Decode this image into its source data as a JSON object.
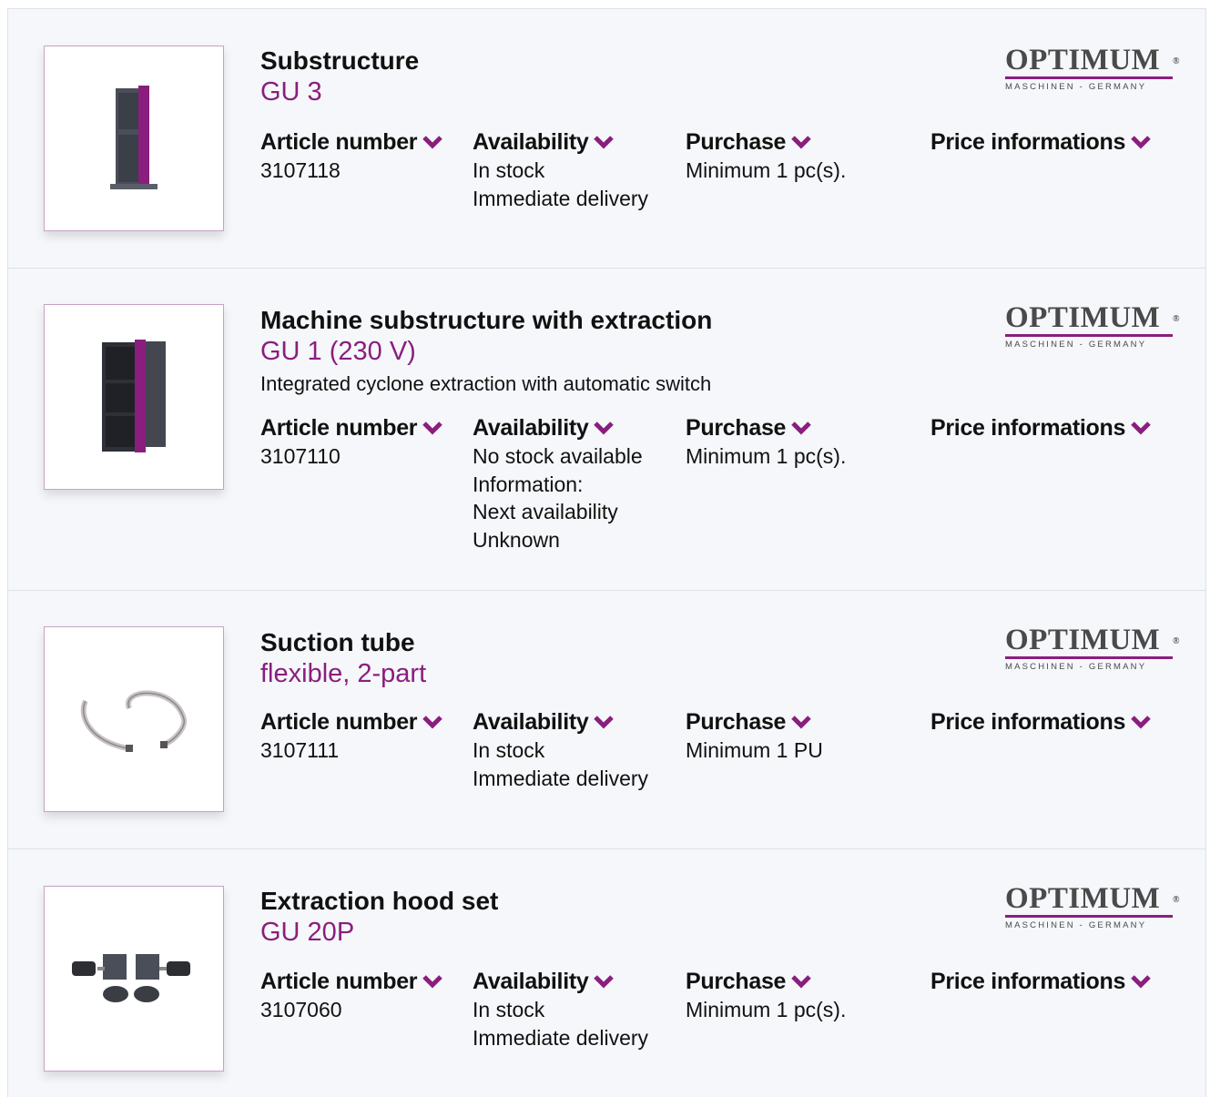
{
  "products": [
    {
      "title": "Substructure",
      "model": "GU 3",
      "description": "",
      "image": "tall-cabinet-stand",
      "article_label": "Article number",
      "article_number": "3107118",
      "availability_label": "Availability",
      "availability_lines": [
        "In stock",
        "Immediate delivery"
      ],
      "purchase_label": "Purchase",
      "purchase_text": "Minimum 1 pc(s).",
      "price_label": "Price informations",
      "brand": {
        "name": "OPTIMUM",
        "reg": "®",
        "tagline": "MASCHINEN - GERMANY"
      }
    },
    {
      "title": "Machine substructure with extraction",
      "model": "GU 1 (230 V)",
      "description": "Integrated cyclone extraction with automatic switch",
      "image": "cabinet-with-extraction",
      "article_label": "Article number",
      "article_number": "3107110",
      "availability_label": "Availability",
      "availability_lines": [
        "No stock available",
        "Information:",
        "Next availability",
        "Unknown"
      ],
      "purchase_label": "Purchase",
      "purchase_text": "Minimum 1 pc(s).",
      "price_label": "Price informations",
      "brand": {
        "name": "OPTIMUM",
        "reg": "®",
        "tagline": "MASCHINEN - GERMANY"
      }
    },
    {
      "title": "Suction tube",
      "model": "flexible, 2-part",
      "description": "",
      "image": "flexible-tubes",
      "article_label": "Article number",
      "article_number": "3107111",
      "availability_label": "Availability",
      "availability_lines": [
        "In stock",
        "Immediate delivery"
      ],
      "purchase_label": "Purchase",
      "purchase_text": "Minimum 1 PU",
      "price_label": "Price informations",
      "brand": {
        "name": "OPTIMUM",
        "reg": "®",
        "tagline": "MASCHINEN - GERMANY"
      }
    },
    {
      "title": "Extraction hood set",
      "model": "GU 20P",
      "description": "",
      "image": "hood-set",
      "article_label": "Article number",
      "article_number": "3107060",
      "availability_label": "Availability",
      "availability_lines": [
        "In stock",
        "Immediate delivery"
      ],
      "purchase_label": "Purchase",
      "purchase_text": "Minimum 1 pc(s).",
      "price_label": "Price informations",
      "brand": {
        "name": "OPTIMUM",
        "reg": "®",
        "tagline": "MASCHINEN - GERMANY"
      }
    }
  ],
  "colors": {
    "accent": "#8a1e7e",
    "card_bg": "#f5f7fa",
    "border": "#dde3ea"
  }
}
